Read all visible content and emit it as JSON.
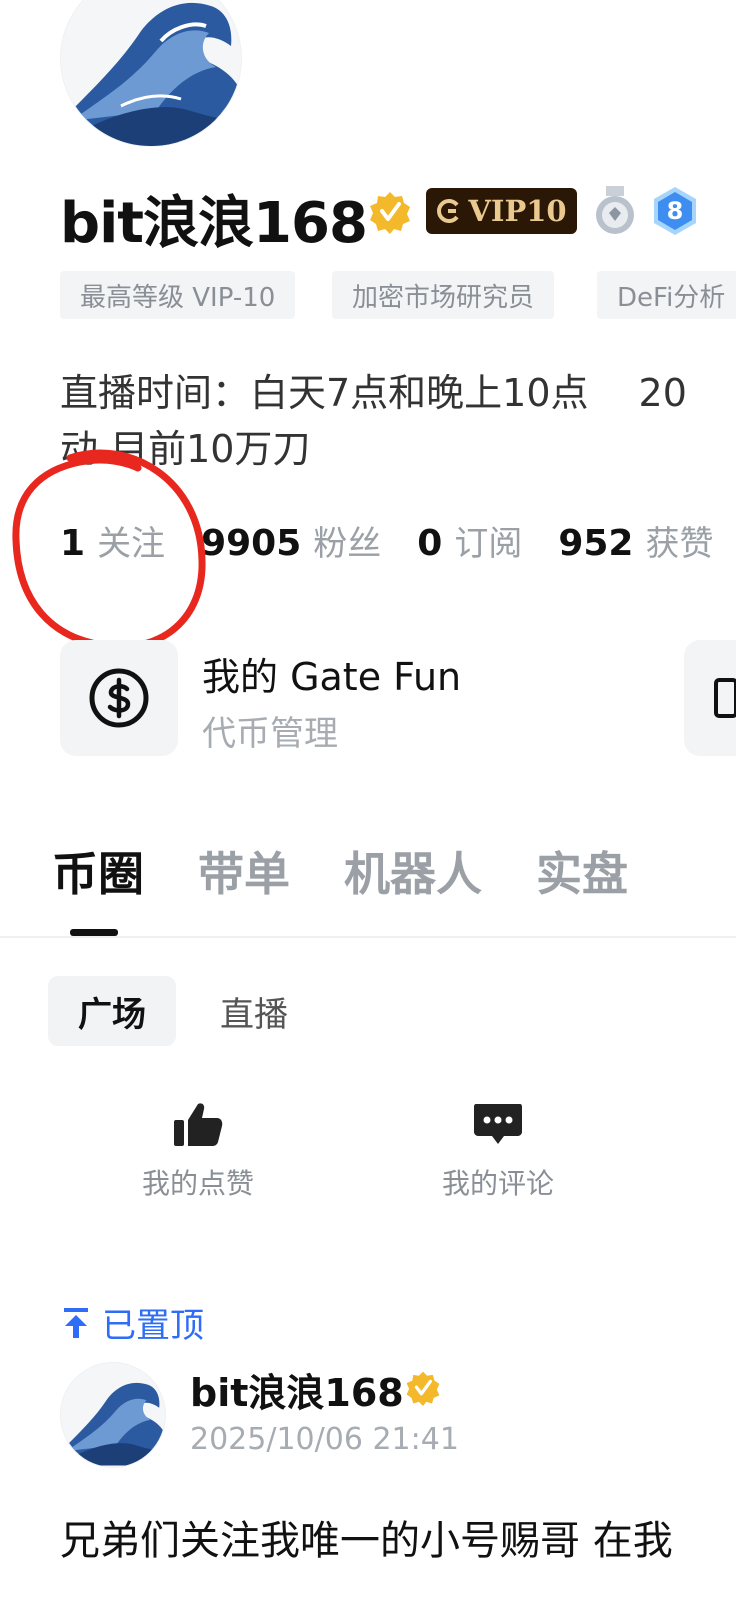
{
  "profile": {
    "username": "bit浪浪168",
    "vip_label": "VIP10",
    "level": "8",
    "tags": [
      "最高等级 VIP-10",
      "加密市场研究员",
      "DeFi分析"
    ],
    "bio_line1_a": "直播时间：白天7点和晚上10点",
    "bio_line1_b": "20",
    "bio_line2": "动 目前10万刀"
  },
  "stats": [
    {
      "num": "1",
      "label": "关注"
    },
    {
      "num": "9905",
      "label": "粉丝"
    },
    {
      "num": "0",
      "label": "订阅"
    },
    {
      "num": "952",
      "label": "获赞"
    }
  ],
  "card": {
    "title": "我的 Gate Fun",
    "subtitle": "代币管理"
  },
  "main_tabs": [
    "币圈",
    "带单",
    "机器人",
    "实盘"
  ],
  "sub_tabs": [
    "广场",
    "直播"
  ],
  "actions": [
    {
      "label": "我的点赞",
      "icon": "thumbs-up-icon"
    },
    {
      "label": "我的评论",
      "icon": "comment-icon"
    }
  ],
  "pinned_label": "已置顶",
  "post": {
    "author": "bit浪浪168",
    "time": "2025/10/06 21:41",
    "content": "兄弟们关注我唯一的小号赐哥 在我"
  },
  "colors": {
    "accent_blue": "#2f6df6",
    "annotation_red": "#e8281e",
    "vip_bg": "#2a1706",
    "vip_gold": "#e9c98f"
  }
}
